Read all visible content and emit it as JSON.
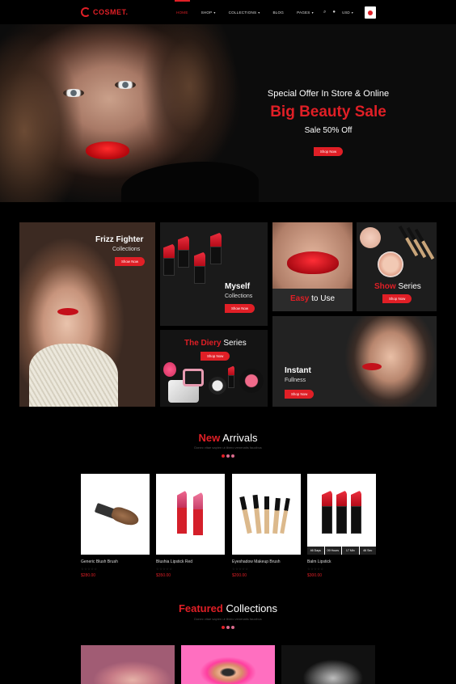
{
  "header": {
    "logo": "COSMET.",
    "nav": [
      {
        "label": "HOME",
        "active": true,
        "caret": false
      },
      {
        "label": "SHOP",
        "active": false,
        "caret": true
      },
      {
        "label": "COLLECTIONS",
        "active": false,
        "caret": true
      },
      {
        "label": "BLOG",
        "active": false,
        "caret": false
      },
      {
        "label": "PAGES",
        "active": false,
        "caret": true
      }
    ],
    "currency": "USD",
    "icons": [
      "search-icon",
      "user-icon",
      "cart-icon"
    ]
  },
  "hero": {
    "subtitle": "Special Offer In Store & Online",
    "title": "Big Beauty Sale",
    "sale": "Sale 50% Off",
    "button": "Shop Now"
  },
  "collections": {
    "frizz": {
      "title": "Frizz Fighter",
      "sub": "Collections",
      "button": "Show Now"
    },
    "myself": {
      "title": "Myself",
      "sub": "Collections",
      "button": "Show Now"
    },
    "easy": {
      "title_a": "Easy",
      "title_b": " to Use"
    },
    "show": {
      "title_a": "Show",
      "title_b": " Series",
      "button": "Shop Now"
    },
    "diery": {
      "title_a": "The Diery",
      "title_b": " Series",
      "button": "Shop Now"
    },
    "instant": {
      "title": "Instant",
      "sub": "Fullness",
      "button": "Shop Now"
    }
  },
  "new_arrivals": {
    "title_a": "New",
    "title_b": " Arrivals",
    "desc": "Donec vitae sapien ut libero venenatis faucibus",
    "products": [
      {
        "name": "Generic Blush Brush",
        "stars": "☆☆☆☆☆",
        "price": "$280.00"
      },
      {
        "name": "Blushia Lipstick Red",
        "stars": "☆☆☆☆☆",
        "price": "$350.00"
      },
      {
        "name": "Eyeshadow Makeup Brush",
        "stars": "☆☆☆☆☆",
        "price": "$200.00"
      },
      {
        "name": "Balm Lipstick",
        "stars": "☆☆☆☆☆",
        "price": "$300.00"
      }
    ],
    "countdown": [
      "46 Days",
      "09 Hours",
      "17 Min",
      "46 Sec"
    ]
  },
  "featured": {
    "title_a": "Featured",
    "title_b": " Collections",
    "desc": "Donec vitae sapien ut libero venenatis faucibus"
  },
  "colors": {
    "accent": "#e01f26",
    "background": "#000000",
    "pink_dot": "#d96a8c"
  }
}
